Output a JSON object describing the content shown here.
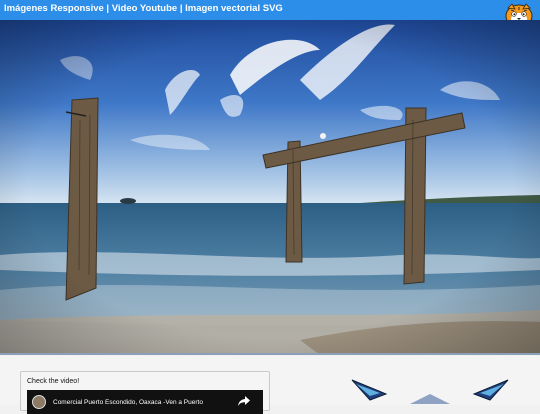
{
  "header": {
    "title": "Imágenes Responsive | Video Youtube | Imagen vectorial SVG"
  },
  "video": {
    "label": "Check the video!",
    "title": "Comercial Puerto Escondido, Oaxaca -Ven a Puerto"
  },
  "icons": {
    "logo": "tiger-face-logo-icon",
    "share": "share-icon",
    "channel": "channel-avatar",
    "vector": "blue-wing-vector-icon"
  },
  "colors": {
    "header_bg": "#2d8ee9",
    "header_text": "#ffffff",
    "sky": "#2f5fb0",
    "sea": "#4f7ea0",
    "page_bg": "#f1f1f1"
  }
}
